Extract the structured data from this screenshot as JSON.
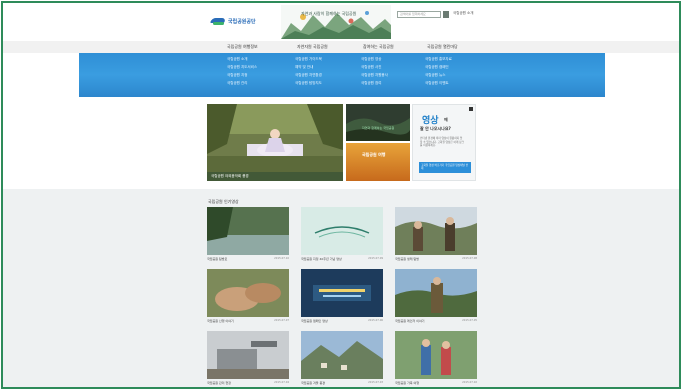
{
  "header": {
    "logo_text": "국립공원공단",
    "banner_text": "자연과 사람이 함께하는 국립공원",
    "search_placeholder": "검색어를 입력하세요",
    "util_link": "국립공원 소개"
  },
  "gnb": {
    "items": [
      "국립공원 여행정보",
      "자연자원 국립공원",
      "참여하는 국립공원",
      "국립공원 열린마당"
    ]
  },
  "mega": {
    "columns": [
      [
        "국립공원 소개",
        "국립공원 지도서비스",
        "국립공원 지정",
        "국립공원 관리"
      ],
      [
        "국립공원 가이드북",
        "예약 및 안내",
        "국립공원 자연환경",
        "국립공원 탐방지도"
      ],
      [
        "국립공원 영상",
        "국립공원 사진",
        "국립공원 자원봉사",
        "국립공원 참여"
      ],
      [
        "국립공원 홍보자료",
        "국립공원 캠페인",
        "국립공원 뉴스",
        "국립공원 이벤트"
      ]
    ]
  },
  "visual": {
    "caption": "국립공원 야외음악회 풍경",
    "thumb_a_label": "자연과 함께하는 국립공원",
    "thumb_b_label": "국립공원 여행"
  },
  "promo": {
    "title": "영상",
    "title_suffix": "에",
    "subtitle": "잘 안 나오시나요?",
    "desc": "인터넷 환경에 따라 영상이 원활하지 않을 수 있습니다. 고화질 영상은 아래 링크를 이용하세요.",
    "button": "고화질 영상 바로가기 국립공원 영상채널 안내"
  },
  "section": {
    "title": "국립공원 인기영상"
  },
  "cards": [
    {
      "title": "국립공원 탐방로",
      "meta": "2015.07.10"
    },
    {
      "title": "국립공원 지정 40주년 기념 영상",
      "meta": "2015.07.09"
    },
    {
      "title": "국립공원 생태 탐방",
      "meta": "2015.07.08"
    },
    {
      "title": "국립공원 산행 이야기",
      "meta": "2015.07.07"
    },
    {
      "title": "국립공원 캠페인 영상",
      "meta": "2015.07.06"
    },
    {
      "title": "국립공원 레인저 이야기",
      "meta": "2015.07.05"
    },
    {
      "title": "국립공원 관리 현장",
      "meta": "2015.07.04"
    },
    {
      "title": "국립공원 겨울 풍경",
      "meta": "2015.07.03"
    },
    {
      "title": "국립공원 가족 여행",
      "meta": "2015.07.02"
    }
  ],
  "colors": {
    "frame_border": "#2e8b5a",
    "mega_blue": "#3a9de0",
    "promo_blue": "#1f7fc8",
    "grey_bg": "#eef1f2"
  }
}
